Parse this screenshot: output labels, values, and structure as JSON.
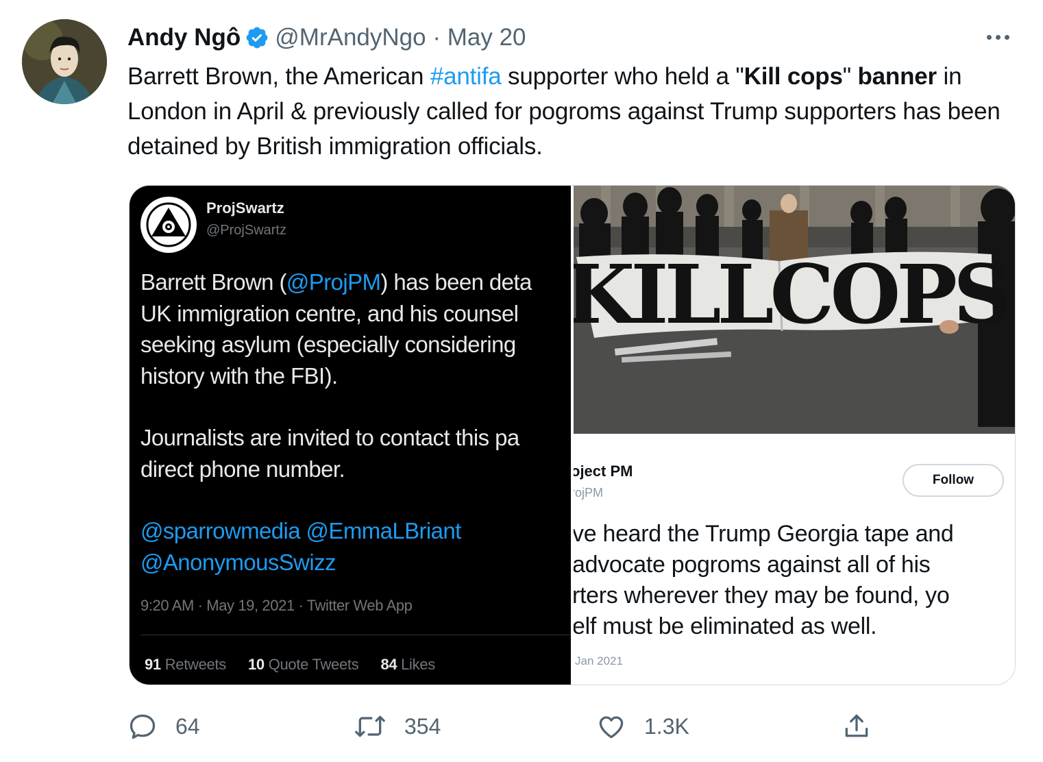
{
  "tweet": {
    "author_name": "Andy Ngô",
    "handle": "@MrAndyNgo",
    "separator": "·",
    "date": "May 20",
    "text": {
      "p1": "Barrett Brown, the American ",
      "hashtag": "#antifa",
      "p2": " supporter who held a \"",
      "bold1": "Kill cops",
      "p3": "\" ",
      "bold2": "banner",
      "p4": " in London in April & previously called for pogroms against Trump supporters has been detained by British immigration officials."
    }
  },
  "media": {
    "left": {
      "name": "ProjSwartz",
      "handle": "@ProjSwartz",
      "line1_a": "Barrett Brown (",
      "line1_mention": "@ProjPM",
      "line1_b": ") has been deta",
      "line2": "UK  immigration centre, and his counsel",
      "line3": "seeking asylum (especially considering",
      "line4": "history with the FBI).",
      "line5": "Journalists are invited to contact this pa",
      "line6": "direct phone number.",
      "mention1": "@sparrowmedia",
      "mention2": "@EmmaLBriant",
      "mention3": "@AnonymousSwizz",
      "timestamp": "9:20 AM · May 19, 2021 · Twitter Web App",
      "retweets_count": "91",
      "retweets_label": "Retweets",
      "quotes_count": "10",
      "quotes_label": "Quote Tweets",
      "likes_count": "84",
      "likes_label": "Likes"
    },
    "right": {
      "banner_text": "KILLCOPS",
      "name": "oject PM",
      "handle": "rojPM",
      "follow_label": "Follow",
      "line1": "ve heard the Trump Georgia tape and",
      "line2": "advocate pogroms against all of his",
      "line3": "rters wherever they may be found, yo",
      "line4": "elf must be eliminated as well.",
      "date": "Jan 2021"
    }
  },
  "actions": {
    "replies": "64",
    "retweets": "354",
    "likes": "1.3K"
  },
  "colors": {
    "link": "#1d9bf0",
    "secondary_text": "#536471",
    "primary_text": "#0f1419"
  }
}
